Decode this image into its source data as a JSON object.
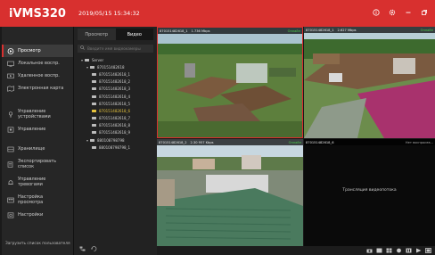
{
  "app": {
    "title": "iVMS320",
    "datetime": "2019/05/15 15:34:32"
  },
  "window_controls": [
    "info-icon",
    "settings-icon",
    "minimize-icon",
    "restore-icon"
  ],
  "sidebar": {
    "items": [
      {
        "label": "Просмотр",
        "icon": "monitor-icon",
        "active": true
      },
      {
        "label": "Локальное воспр.",
        "icon": "local-playback-icon"
      },
      {
        "label": "Удаленное воспр.",
        "icon": "remote-playback-icon"
      },
      {
        "label": "Электронная карта",
        "icon": "map-icon"
      },
      {
        "label": "Управление устройствами",
        "icon": "device-icon"
      },
      {
        "label": "Управление",
        "icon": "manage-icon"
      },
      {
        "label": "Хранилище",
        "icon": "storage-icon"
      },
      {
        "label": "Экспортировать список",
        "icon": "export-icon"
      },
      {
        "label": "Управление тревогами",
        "icon": "alarm-icon"
      },
      {
        "label": "Настройка просмотра",
        "icon": "view-config-icon"
      },
      {
        "label": "Настройки",
        "icon": "settings-icon"
      }
    ],
    "footer": "Загрузить список пользователя"
  },
  "tree": {
    "tabs": [
      "Просмотр",
      "Видео"
    ],
    "active_tab": 1,
    "search_placeholder": "Введите имя видеокамеры",
    "rows": [
      {
        "label": "Server",
        "level": 0,
        "type": "group"
      },
      {
        "label": "870151482618",
        "level": 1,
        "type": "device"
      },
      {
        "label": "870151482618_1",
        "level": 2,
        "type": "camera"
      },
      {
        "label": "870151482618_2",
        "level": 2,
        "type": "camera"
      },
      {
        "label": "870151482618_3",
        "level": 2,
        "type": "camera"
      },
      {
        "label": "870151482618_4",
        "level": 2,
        "type": "camera"
      },
      {
        "label": "870151482618_5",
        "level": 2,
        "type": "camera"
      },
      {
        "label": "870151482618_6",
        "level": 2,
        "type": "camera",
        "highlight": true
      },
      {
        "label": "870151482618_7",
        "level": 2,
        "type": "camera"
      },
      {
        "label": "870151482618_8",
        "level": 2,
        "type": "camera"
      },
      {
        "label": "870151482618_9",
        "level": 2,
        "type": "camera"
      },
      {
        "label": "880108798798",
        "level": 1,
        "type": "device"
      },
      {
        "label": "880108798798_1",
        "level": 2,
        "type": "camera"
      }
    ]
  },
  "tiles": [
    {
      "camera": "870151482618_1",
      "bitrate": "1.736 Mbps",
      "status": "Онлайн"
    },
    {
      "camera": "870151482618_1",
      "bitrate": "2.627 Mbps",
      "status": "Онлайн"
    },
    {
      "camera": "870151482618_2",
      "bitrate": "2.30 957 Kbps",
      "status": "Онлайн"
    },
    {
      "camera": "870151482618_6",
      "bitrate": "",
      "status": "Нет воспроизв...",
      "message": "Трансляция видеопотока"
    }
  ],
  "colors": {
    "accent": "#d8302f",
    "online": "#4ccf4c",
    "highlight": "#e6c33d"
  }
}
